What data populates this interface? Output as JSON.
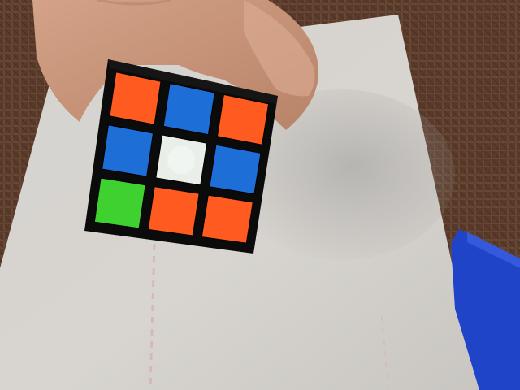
{
  "scene": {
    "subject": "rubiks-cube-face",
    "cube_face": {
      "grid": [
        [
          "orange",
          "blue",
          "orange"
        ],
        [
          "blue",
          "white",
          "blue"
        ],
        [
          "green",
          "orange",
          "orange"
        ]
      ]
    },
    "colors": {
      "orange": "#ff5a1f",
      "blue": "#1e6ed8",
      "green": "#3fd12f",
      "white": "#e9efe8",
      "cube_body": "#0b0b0c",
      "paper": "#d9d6d1",
      "mat": "#6a4a36",
      "blue_object": "#1f44c8",
      "skin": "#c89478"
    }
  }
}
